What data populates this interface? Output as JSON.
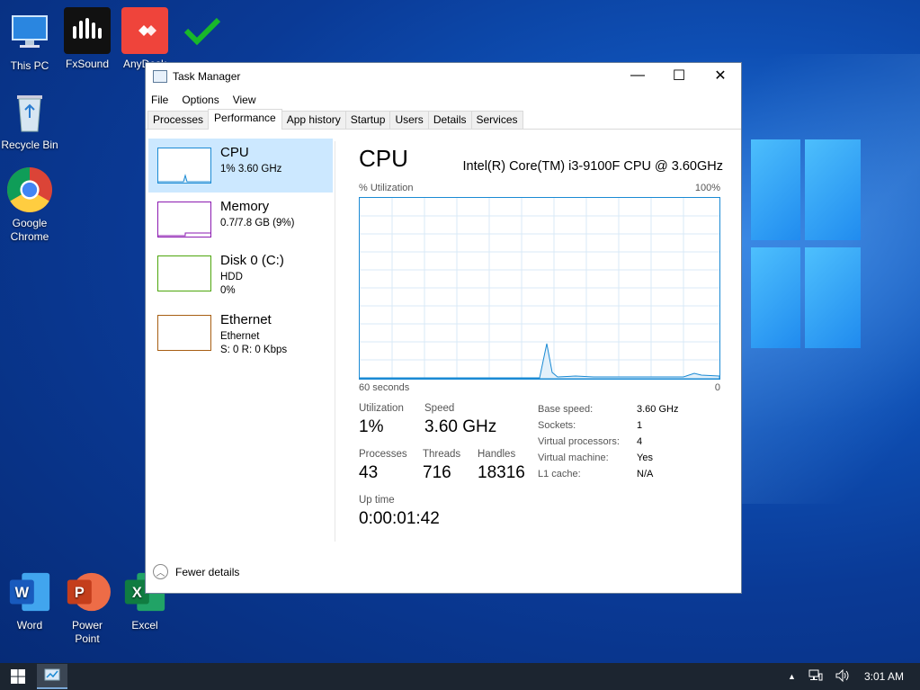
{
  "desktop": {
    "icons": [
      {
        "label": "This PC"
      },
      {
        "label": "FxSound"
      },
      {
        "label": "AnyDesk"
      },
      {
        "label": "Recycle Bin"
      },
      {
        "label": "Google Chrome"
      },
      {
        "label": "Word"
      },
      {
        "label": "Power Point"
      },
      {
        "label": "Excel"
      }
    ]
  },
  "window": {
    "title": "Task Manager",
    "controls": {
      "minimize": "—",
      "maximize": "☐",
      "close": "✕"
    },
    "menu": [
      "File",
      "Options",
      "View"
    ],
    "tabs": [
      "Processes",
      "Performance",
      "App history",
      "Startup",
      "Users",
      "Details",
      "Services"
    ],
    "active_tab": "Performance"
  },
  "sidebar": {
    "items": [
      {
        "name": "CPU",
        "sub1": "1%  3.60 GHz",
        "sub2": "",
        "color": "#1a8ad4"
      },
      {
        "name": "Memory",
        "sub1": "0.7/7.8 GB (9%)",
        "sub2": "",
        "color": "#8b1ab0"
      },
      {
        "name": "Disk 0 (C:)",
        "sub1": "HDD",
        "sub2": "0%",
        "color": "#4da60c"
      },
      {
        "name": "Ethernet",
        "sub1": "Ethernet",
        "sub2": "S: 0 R: 0 Kbps",
        "color": "#a75e12"
      }
    ]
  },
  "cpu": {
    "title": "CPU",
    "model": "Intel(R) Core(TM) i3-9100F CPU @ 3.60GHz",
    "graph": {
      "ylabel": "% Utilization",
      "ymax_label": "100%",
      "xleft_label": "60 seconds",
      "xright_label": "0"
    },
    "stats": {
      "utilization_label": "Utilization",
      "utilization": "1%",
      "speed_label": "Speed",
      "speed": "3.60 GHz",
      "processes_label": "Processes",
      "processes": "43",
      "threads_label": "Threads",
      "threads": "716",
      "handles_label": "Handles",
      "handles": "18316",
      "uptime_label": "Up time",
      "uptime": "0:00:01:42"
    },
    "details": [
      {
        "label": "Base speed:",
        "value": "3.60 GHz"
      },
      {
        "label": "Sockets:",
        "value": "1"
      },
      {
        "label": "Virtual processors:",
        "value": "4"
      },
      {
        "label": "Virtual machine:",
        "value": "Yes"
      },
      {
        "label": "L1 cache:",
        "value": "N/A"
      }
    ]
  },
  "footer": {
    "label": "Fewer details"
  },
  "taskbar": {
    "time": "3:01 AM"
  }
}
